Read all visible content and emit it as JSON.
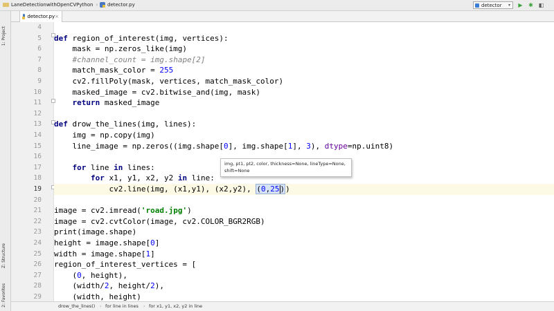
{
  "nav": {
    "project": "LaneDetectionwithOpenCVPython",
    "file": "detector.py",
    "run_config": "detector"
  },
  "tab": {
    "label": "detector.py"
  },
  "toolstrip": {
    "project": "1: Project",
    "structure": "Z: Structure",
    "favorites": "2: Favorites"
  },
  "editor": {
    "line_numbers": [
      "4",
      "5",
      "6",
      "7",
      "8",
      "9",
      "10",
      "11",
      "12",
      "13",
      "14",
      "15",
      "16",
      "17",
      "18",
      "19",
      "20",
      "21",
      "22",
      "23",
      "24",
      "25",
      "26",
      "27",
      "28",
      "29"
    ],
    "current_line": "19"
  },
  "tooltip": {
    "line1": "img, pt1, pt2, color, thickness=None, lineType=None,",
    "line2": "shift=None"
  },
  "breadcrumbs": [
    "drow_the_lines()",
    "for line in lines",
    "for x1, y1, x2, y2 in line"
  ],
  "colors": {
    "keyword": "#000080",
    "string": "#008000",
    "number": "#0000ff",
    "comment": "#808080",
    "current_line": "#fcfae4"
  }
}
